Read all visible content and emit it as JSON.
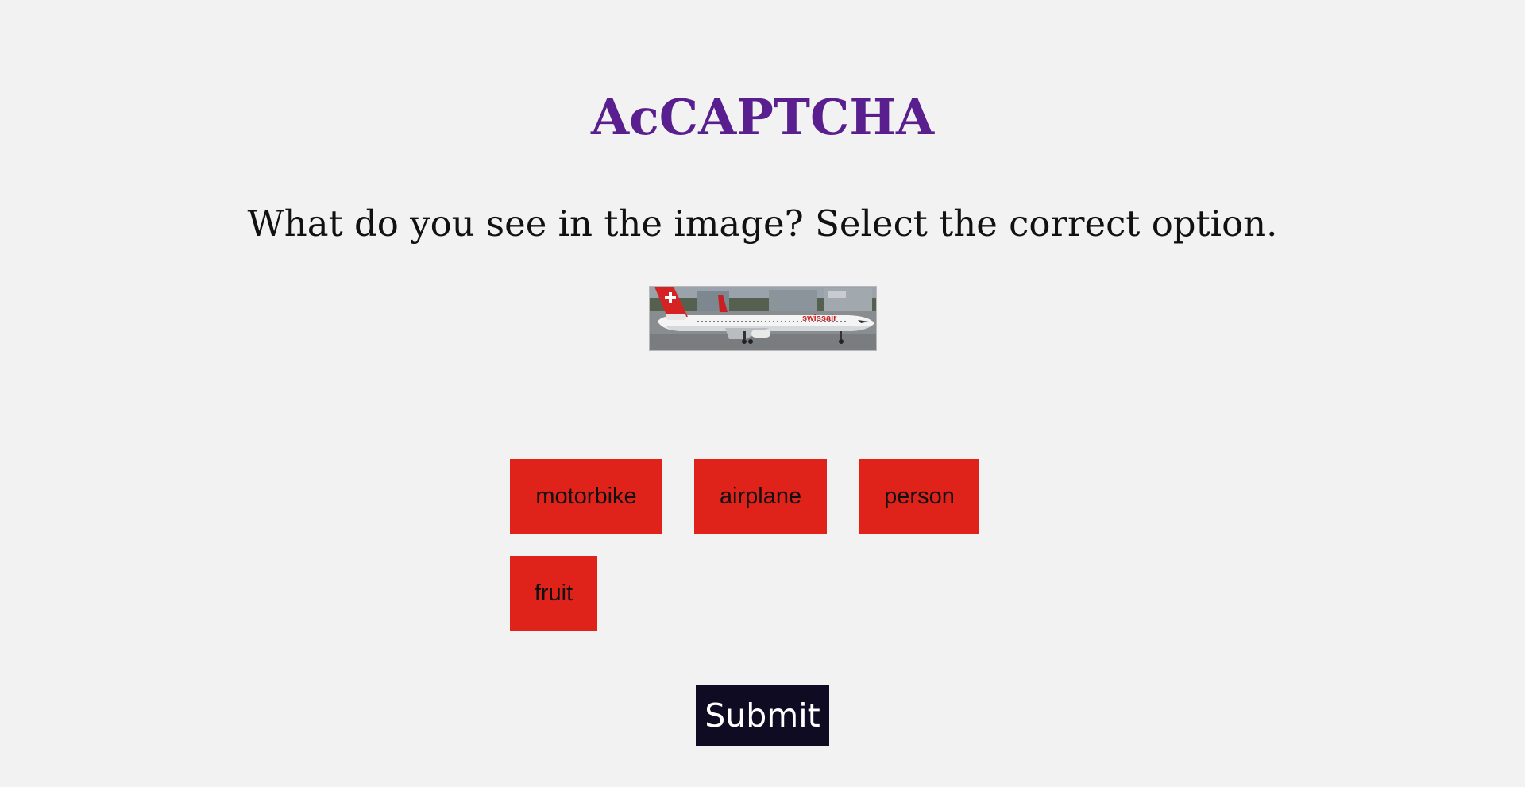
{
  "page": {
    "title": "AcCAPTCHA",
    "question": "What do you see in the image? Select the correct option."
  },
  "captcha": {
    "image_alt": "airplane photo",
    "aircraft_livery_text": "swissair"
  },
  "options": [
    {
      "label": "motorbike"
    },
    {
      "label": "airplane"
    },
    {
      "label": "person"
    },
    {
      "label": "fruit"
    }
  ],
  "submit_label": "Submit",
  "colors": {
    "background": "#f2f2f2",
    "title": "#5a1f8e",
    "option_button": "#e0231a",
    "submit_button": "#0f0b22",
    "submit_text": "#ffffff"
  }
}
